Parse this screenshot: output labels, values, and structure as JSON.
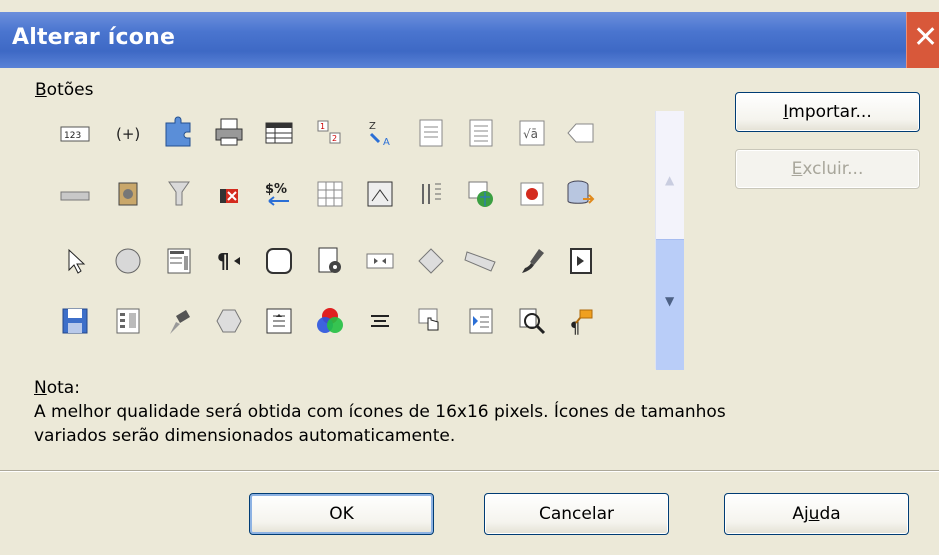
{
  "dialog": {
    "title": "Alterar ícone",
    "close_glyph": "✕"
  },
  "buttons_label": {
    "underlined": "B",
    "rest": "otões"
  },
  "icons": [
    [
      "number-field-icon",
      "paren-icon",
      "puzzle-icon",
      "printer-icon",
      "table-icon",
      "icon-sequence",
      "sort-az-icon",
      "document-icon",
      "document-lines-icon",
      "formula-icon",
      "tag-icon"
    ],
    [
      "bar-icon",
      "film-icon",
      "filter-icon",
      "delete-red-icon",
      "currency-icon",
      "grid-icon",
      "image-edit-icon",
      "columns-icon",
      "chart-map-icon",
      "record-icon",
      "database-icon"
    ],
    [
      "pointer-icon",
      "circle-icon",
      "list-box-icon",
      "pilcrow-icon",
      "rounded-rect-icon",
      "document-gear-icon",
      "media-icon",
      "diamond-icon",
      "parallelogram-icon",
      "brush-icon",
      "slideshow-icon"
    ],
    [
      "save-icon",
      "form-icon",
      "paint-bucket-icon",
      "hexagon-icon",
      "navigator-icon",
      "color-wheel-icon",
      "align-center-icon",
      "hand-pointer-icon",
      "document-arrow-icon",
      "zoom-icon",
      "paragraph-style-icon"
    ]
  ],
  "actions": {
    "import": {
      "ul": "I",
      "rest": "mportar..."
    },
    "delete": {
      "ul": "E",
      "rest": "xcluir..."
    }
  },
  "note": {
    "label_ul": "N",
    "label_rest": "ota:",
    "line1": "A melhor qualidade será obtida com ícones de 16x16 pixels. Ícones de tamanhos",
    "line2": "variados serão dimensionados automaticamente."
  },
  "footer": {
    "ok": "OK",
    "cancel": "Cancelar",
    "help_pre": "Aj",
    "help_ul": "u",
    "help_post": "da"
  },
  "colors": {
    "title_bar": "#4a75cf",
    "close_button": "#d8583a",
    "dialog_bg": "#ece9d8",
    "button_border": "#003c74"
  }
}
